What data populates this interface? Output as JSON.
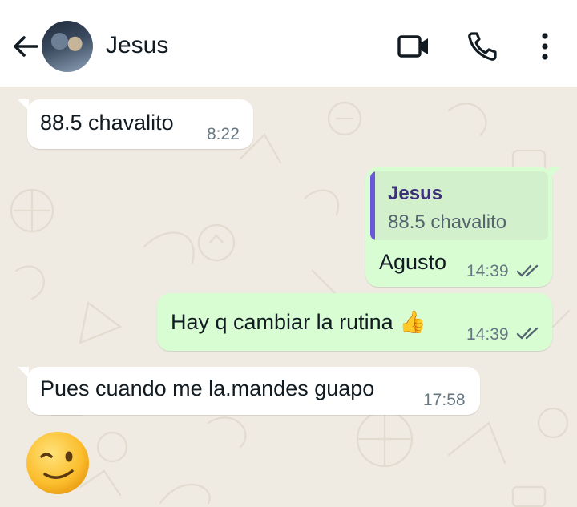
{
  "contact": {
    "name": "Jesus"
  },
  "icons": {
    "back": "arrow-left-icon",
    "video": "video-camera-icon",
    "call": "phone-icon",
    "more": "more-vert-icon",
    "read": "double-check-icon"
  },
  "colors": {
    "header_bg": "#ffffff",
    "chat_bg": "#efeae2",
    "incoming_bubble": "#ffffff",
    "outgoing_bubble": "#d9fdd3",
    "quote_bar": "#6b55d9",
    "read_ticks": "#54656f"
  },
  "messages": [
    {
      "direction": "in",
      "text": "88.5 chavalito",
      "time": "8:22"
    },
    {
      "direction": "out",
      "quote": {
        "author": "Jesus",
        "text": "88.5 chavalito"
      },
      "text": "Agusto",
      "time": "14:39",
      "status": "read"
    },
    {
      "direction": "out",
      "text": "Hay q cambiar la rutina 👍",
      "time": "14:39",
      "status": "read"
    },
    {
      "direction": "in",
      "text": "Pues cuando me la.mandes guapo",
      "time": "17:58"
    },
    {
      "direction": "in",
      "text": "😉",
      "type": "emoji"
    }
  ]
}
